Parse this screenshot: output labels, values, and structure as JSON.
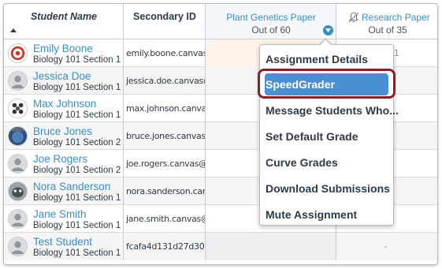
{
  "header": {
    "student_name": "Student Name",
    "secondary_id": "Secondary ID",
    "assignment1": {
      "title": "Plant Genetics Paper",
      "points": "Out of 60"
    },
    "assignment2": {
      "title": "Research Paper",
      "points": "Out of 35"
    }
  },
  "students": [
    {
      "name": "Emily Boone",
      "section": "Biology 101 Section 1",
      "secondary_id": "emily.boone.canvas",
      "grade2": "1"
    },
    {
      "name": "Jessica Doe",
      "section": "Biology 101 Section 1",
      "secondary_id": "jessica.doe.canvas@",
      "grade2": ""
    },
    {
      "name": "Max Johnson",
      "section": "Biology 101 Section 1",
      "secondary_id": "max.johnson.canva",
      "grade2": ""
    },
    {
      "name": "Bruce Jones",
      "section": "Biology 101 Section 2",
      "secondary_id": "bruce.jones.canvas",
      "grade2": ""
    },
    {
      "name": "Joe Rogers",
      "section": "Biology 101 Section 2",
      "secondary_id": "joe.rogers.canvas@",
      "grade2": ""
    },
    {
      "name": "Nora Sanderson",
      "section": "Biology 101 Section 1",
      "secondary_id": "nora.sanderson.car",
      "grade2": ""
    },
    {
      "name": "Jane Smith",
      "section": "Biology 101 Section 1",
      "secondary_id": "jane.smith.canvas@",
      "grade2": ""
    },
    {
      "name": "Test Student",
      "section": "Biology 101 Section 1",
      "secondary_id": "fcafa4d131d27d30",
      "grade2": "-"
    }
  ],
  "menu": {
    "items": [
      {
        "label": "Assignment Details"
      },
      {
        "label": "SpeedGrader"
      },
      {
        "label": "Message Students Who..."
      },
      {
        "label": "Set Default Grade"
      },
      {
        "label": "Curve Grades"
      },
      {
        "label": "Download Submissions"
      },
      {
        "label": "Mute Assignment"
      }
    ],
    "selected": "SpeedGrader"
  },
  "colors": {
    "link": "#3a8ec6",
    "selected_bg": "#4a90d4",
    "highlight_ring": "#8c1d2b"
  },
  "icons": {
    "sort": "sort-ascending-icon",
    "assignment_menu": "chevron-down-icon",
    "muted": "bell-slash-icon"
  }
}
